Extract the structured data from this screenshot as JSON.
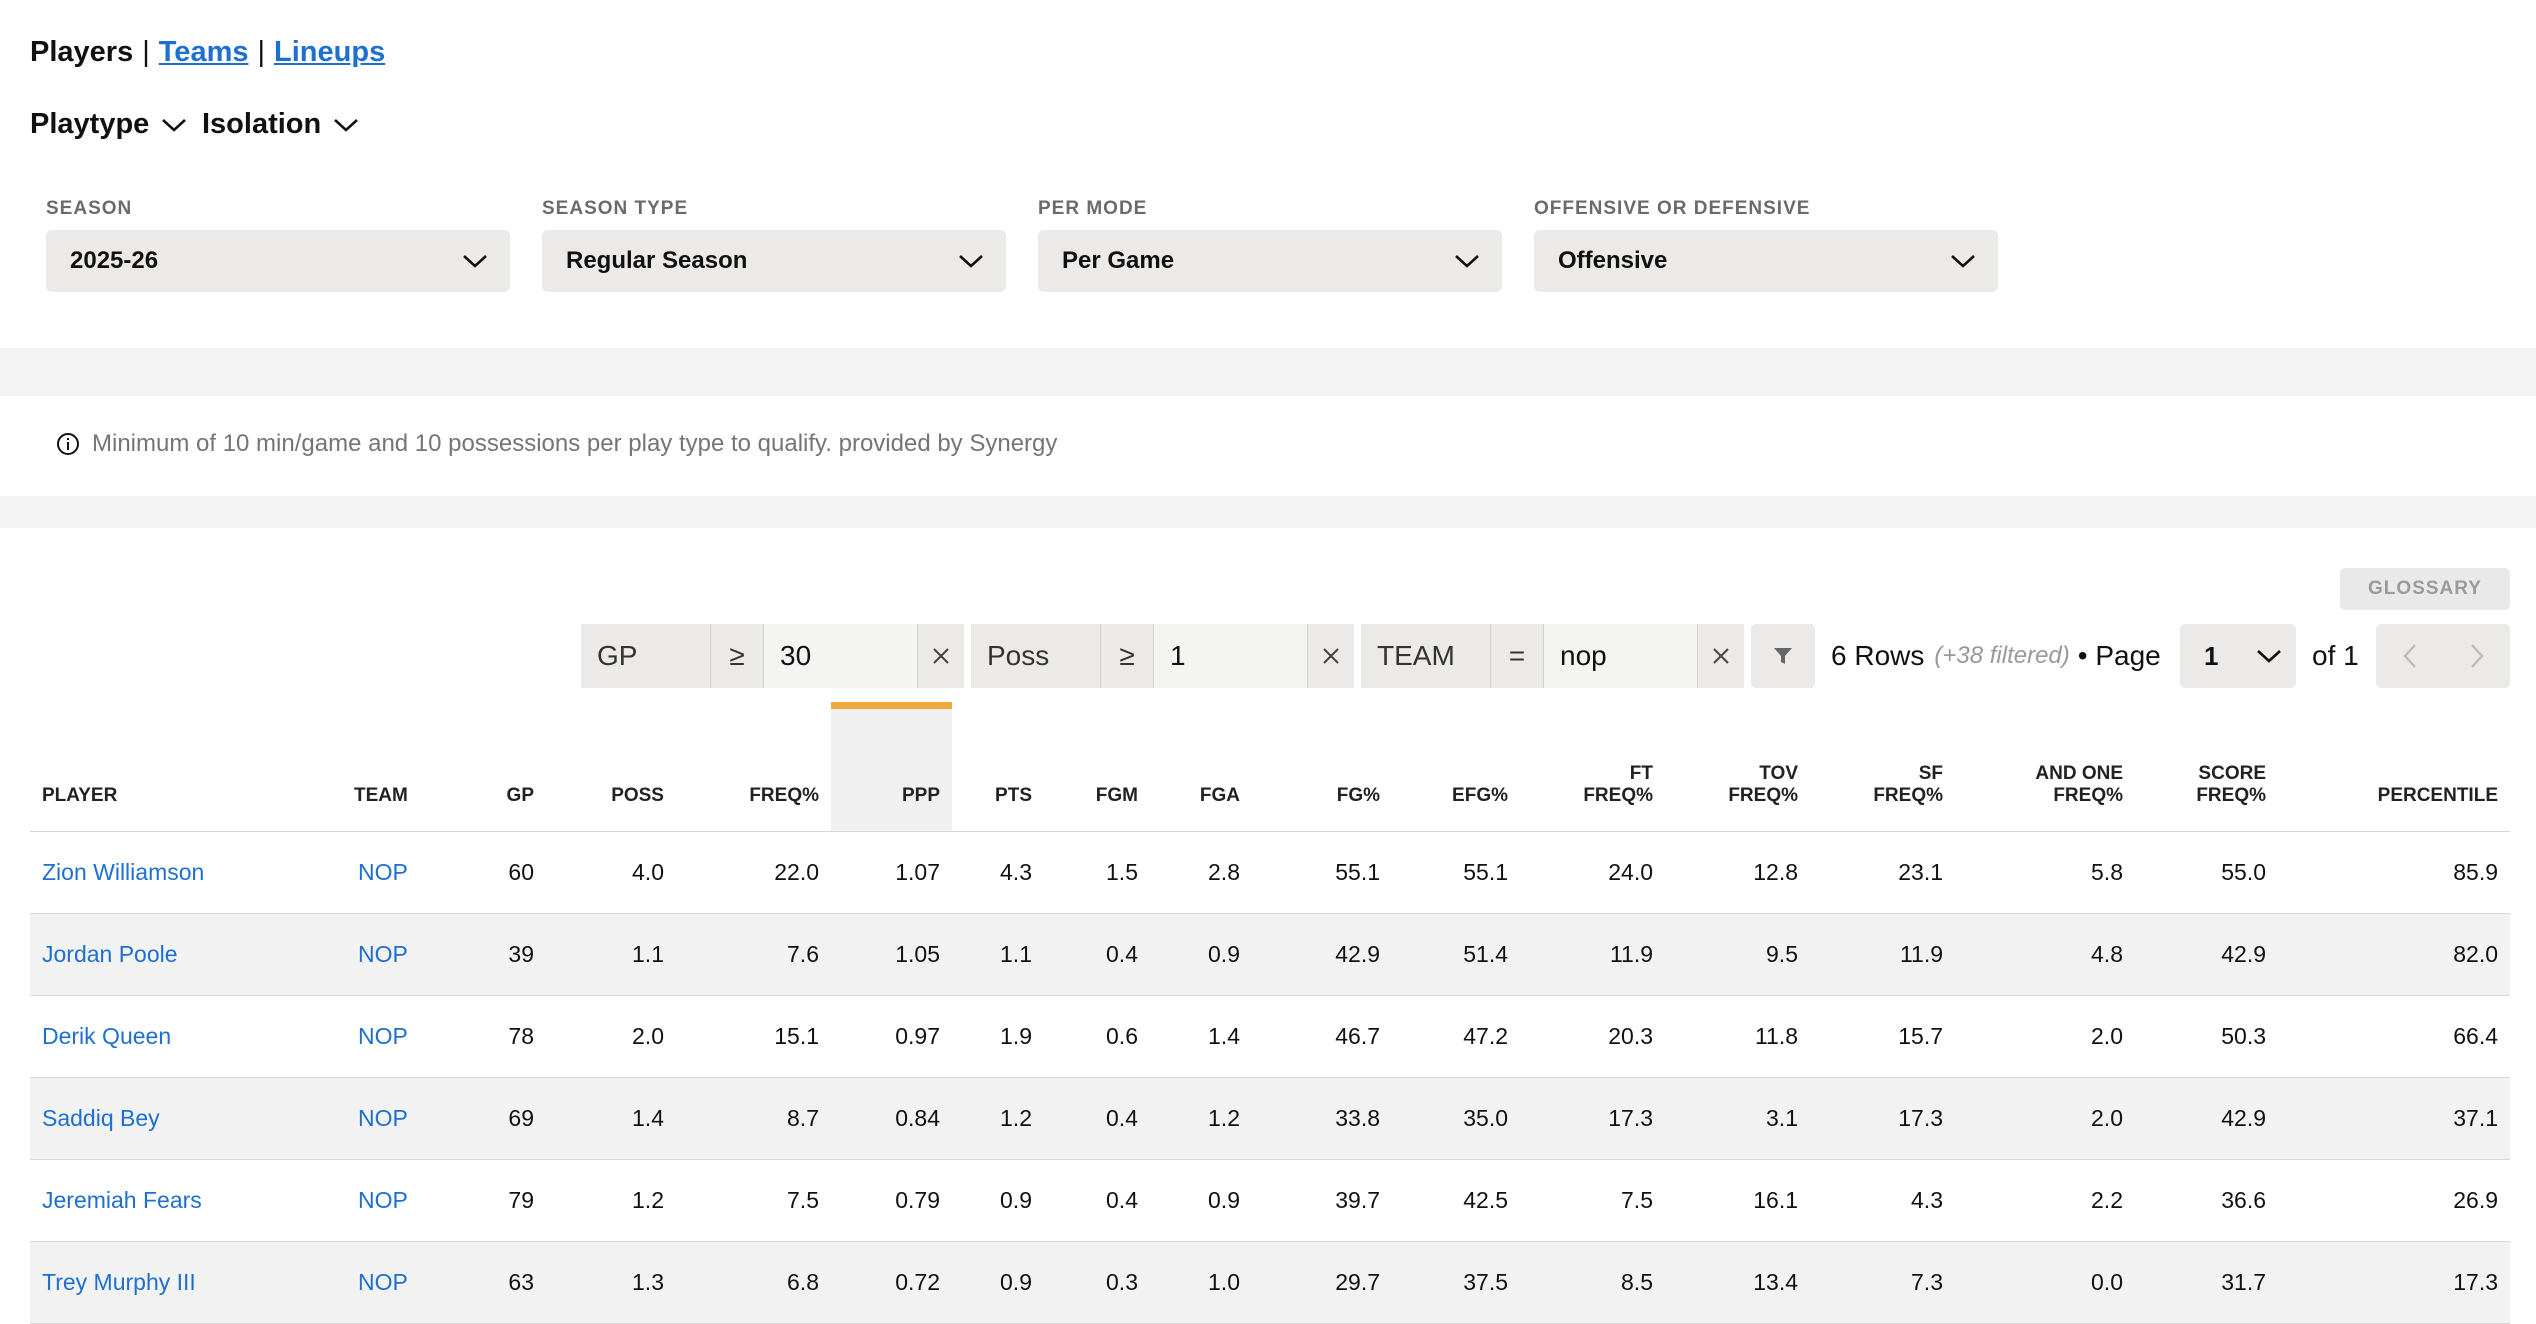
{
  "nav": {
    "players": "Players",
    "sep1": "|",
    "teams": "Teams",
    "sep2": "|",
    "lineups": "Lineups"
  },
  "dropdowns": {
    "playtype": "Playtype",
    "isolation": "Isolation"
  },
  "filters": [
    {
      "label": "SEASON",
      "value": "2025-26"
    },
    {
      "label": "SEASON TYPE",
      "value": "Regular Season"
    },
    {
      "label": "PER MODE",
      "value": "Per Game"
    },
    {
      "label": "OFFENSIVE OR DEFENSIVE",
      "value": "Offensive"
    }
  ],
  "info": "Minimum of 10 min/game and 10 possessions per play type to qualify. provided by Synergy",
  "glossary": "GLOSSARY",
  "table_filters": [
    {
      "field": "GP",
      "op": "≥",
      "value": "30"
    },
    {
      "field": "Poss",
      "op": "≥",
      "value": "1"
    },
    {
      "field": "TEAM",
      "op": "=",
      "value": "nop"
    }
  ],
  "rows_info": {
    "rows": "6 Rows",
    "filtered": "(+38 filtered)",
    "page_label": "• Page",
    "page": "1",
    "of": "of 1"
  },
  "columns": [
    "PLAYER",
    "TEAM",
    "GP",
    "POSS",
    "FREQ%",
    "PPP",
    "PTS",
    "FGM",
    "FGA",
    "FG%",
    "EFG%",
    "FT\nFREQ%",
    "TOV\nFREQ%",
    "SF\nFREQ%",
    "AND ONE\nFREQ%",
    "SCORE\nFREQ%",
    "PERCENTILE"
  ],
  "rows": [
    [
      "Zion Williamson",
      "NOP",
      "60",
      "4.0",
      "22.0",
      "1.07",
      "4.3",
      "1.5",
      "2.8",
      "55.1",
      "55.1",
      "24.0",
      "12.8",
      "23.1",
      "5.8",
      "55.0",
      "85.9"
    ],
    [
      "Jordan Poole",
      "NOP",
      "39",
      "1.1",
      "7.6",
      "1.05",
      "1.1",
      "0.4",
      "0.9",
      "42.9",
      "51.4",
      "11.9",
      "9.5",
      "11.9",
      "4.8",
      "42.9",
      "82.0"
    ],
    [
      "Derik Queen",
      "NOP",
      "78",
      "2.0",
      "15.1",
      "0.97",
      "1.9",
      "0.6",
      "1.4",
      "46.7",
      "47.2",
      "20.3",
      "11.8",
      "15.7",
      "2.0",
      "50.3",
      "66.4"
    ],
    [
      "Saddiq Bey",
      "NOP",
      "69",
      "1.4",
      "8.7",
      "0.84",
      "1.2",
      "0.4",
      "1.2",
      "33.8",
      "35.0",
      "17.3",
      "3.1",
      "17.3",
      "2.0",
      "42.9",
      "37.1"
    ],
    [
      "Jeremiah Fears",
      "NOP",
      "79",
      "1.2",
      "7.5",
      "0.79",
      "0.9",
      "0.4",
      "0.9",
      "39.7",
      "42.5",
      "7.5",
      "16.1",
      "4.3",
      "2.2",
      "36.6",
      "26.9"
    ],
    [
      "Trey Murphy III",
      "NOP",
      "63",
      "1.3",
      "6.8",
      "0.72",
      "0.9",
      "0.3",
      "1.0",
      "29.7",
      "37.5",
      "8.5",
      "13.4",
      "7.3",
      "0.0",
      "31.7",
      "17.3"
    ]
  ],
  "colors": {
    "link": "#1d6fd1",
    "sort_accent": "#f0a93c"
  }
}
